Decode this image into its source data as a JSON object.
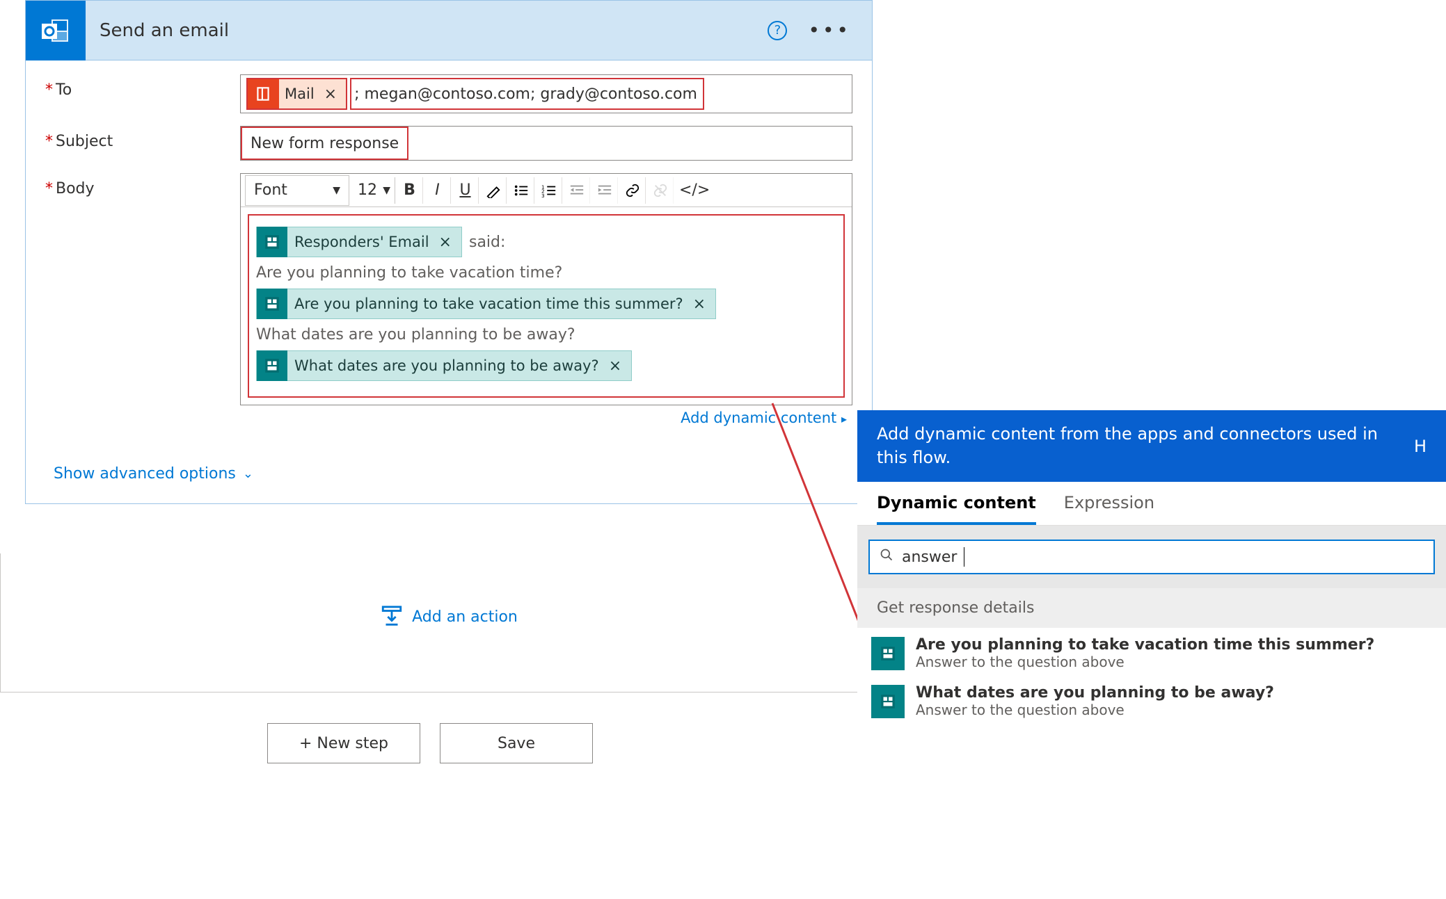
{
  "card": {
    "title": "Send an email",
    "help_tooltip": "?",
    "to": {
      "label": "To",
      "chip_label": "Mail",
      "remainder": "; megan@contoso.com; grady@contoso.com"
    },
    "subject": {
      "label": "Subject",
      "value": "New form response"
    },
    "body": {
      "label": "Body",
      "toolbar": {
        "font_label": "Font",
        "size_label": "12",
        "bold": "B",
        "italic": "I",
        "underline": "U",
        "code": "</>"
      },
      "chip1": "Responders' Email",
      "said_text": "said:",
      "line1": "Are you planning to take vacation time?",
      "chip2": "Are you planning to take vacation time this summer?",
      "line2": "What dates are you planning to be away?",
      "chip3": "What dates are you planning to be away?"
    },
    "add_dynamic": "Add dynamic content",
    "advanced": "Show advanced options"
  },
  "add_action": "Add an action",
  "buttons": {
    "new_step": "+ New step",
    "save": "Save"
  },
  "dc": {
    "header": "Add dynamic content from the apps and connectors used in this flow.",
    "header_h": "H",
    "tab_dynamic": "Dynamic content",
    "tab_expression": "Expression",
    "search_value": "answer",
    "section": "Get response details",
    "items": [
      {
        "t": "Are you planning to take vacation time this summer?",
        "s": "Answer to the question above"
      },
      {
        "t": "What dates are you planning to be away?",
        "s": "Answer to the question above"
      }
    ]
  }
}
